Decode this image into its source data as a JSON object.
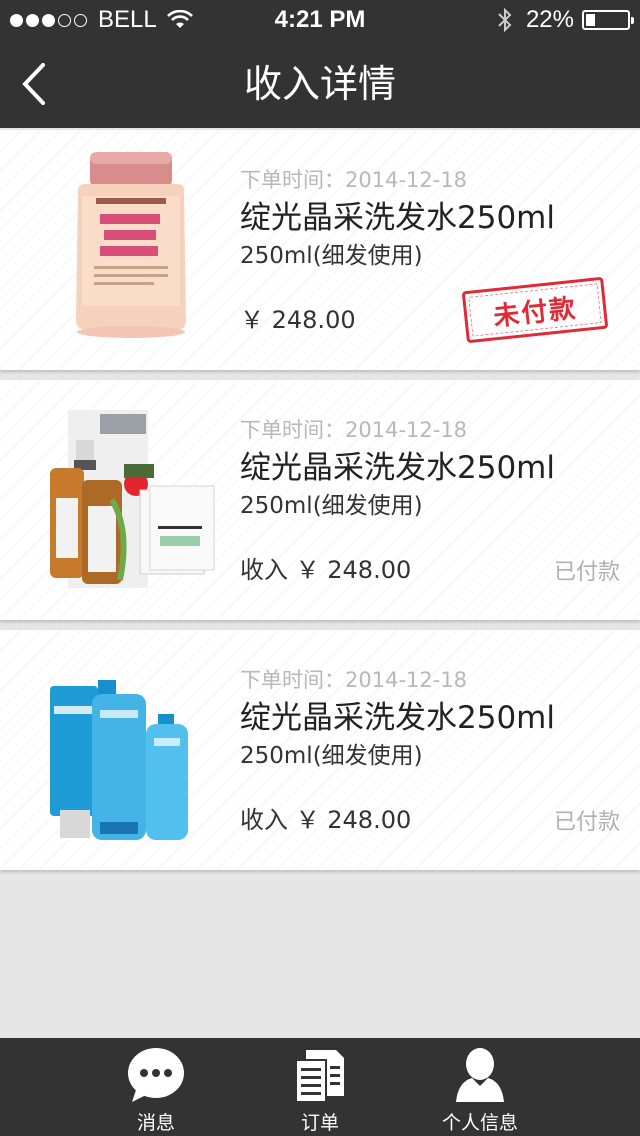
{
  "status_bar": {
    "carrier": "BELL",
    "time": "4:21 PM",
    "battery": "22%",
    "battery_level": 0.22,
    "signal_bars": 3,
    "signal_total": 5
  },
  "nav": {
    "title": "收入详情",
    "back_icon": "chevron-left-icon"
  },
  "orders": [
    {
      "time_label": "下单时间：2014-12-18",
      "name": "绽光晶采洗发水250ml",
      "spec": "250ml(细发使用)",
      "price": "￥ 248.00",
      "status": "未付款",
      "status_style": "stamp"
    },
    {
      "time_label": "下单时间：2014-12-18",
      "name": "绽光晶采洗发水250ml",
      "spec": "250ml(细发使用)",
      "price": "收入 ￥ 248.00",
      "status": "已付款",
      "status_style": "text"
    },
    {
      "time_label": "下单时间：2014-12-18",
      "name": "绽光晶采洗发水250ml",
      "spec": "250ml(细发使用)",
      "price": "收入 ￥ 248.00",
      "status": "已付款",
      "status_style": "text"
    }
  ],
  "tabs": [
    {
      "label": "消息",
      "icon": "chat-bubble-icon"
    },
    {
      "label": "订单",
      "icon": "document-list-icon"
    },
    {
      "label": "个人信息",
      "icon": "person-icon"
    }
  ],
  "colors": {
    "bar": "#333333",
    "background": "#e6e6e6",
    "stamp_red": "#e02a35"
  }
}
